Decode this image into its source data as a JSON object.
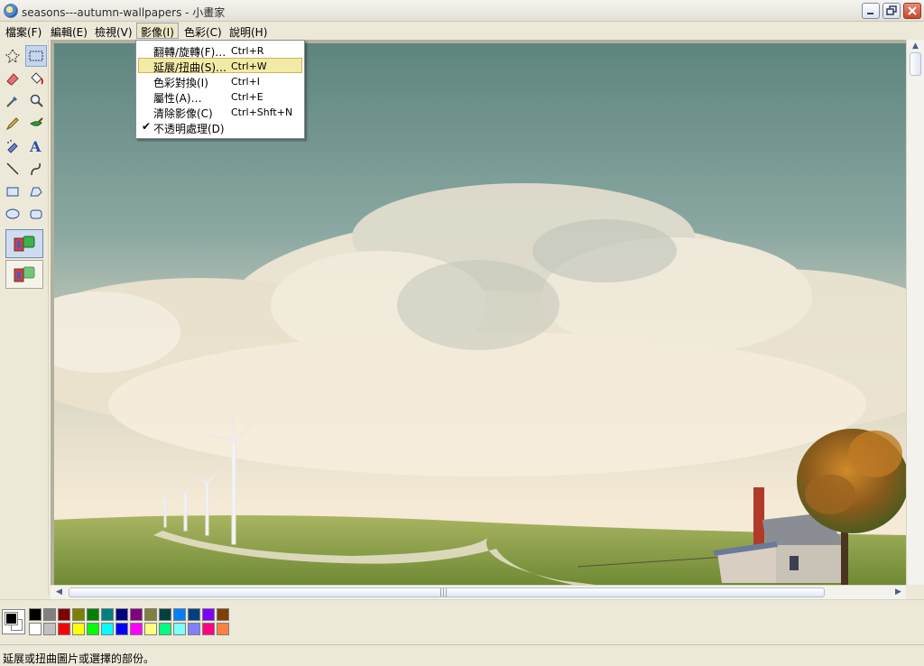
{
  "window": {
    "title": "seasons---autumn-wallpapers - 小畫家"
  },
  "menubar": {
    "file": "檔案(F)",
    "edit": "編輯(E)",
    "view": "檢視(V)",
    "image": "影像(I)",
    "colors": "色彩(C)",
    "help": "說明(H)"
  },
  "image_menu": {
    "items": [
      {
        "label": "翻轉/旋轉(F)…",
        "shortcut": "Ctrl+R"
      },
      {
        "label": "延展/扭曲(S)…",
        "shortcut": "Ctrl+W",
        "highlighted": true
      },
      {
        "label": "色彩對換(I)",
        "shortcut": "Ctrl+I"
      },
      {
        "label": "屬性(A)…",
        "shortcut": "Ctrl+E"
      },
      {
        "label": "清除影像(C)",
        "shortcut": "Ctrl+Shft+N"
      },
      {
        "label": "不透明處理(D)",
        "shortcut": "",
        "checked": true
      }
    ],
    "check_mark": "✔"
  },
  "tools": [
    "free-form-select",
    "select",
    "eraser",
    "fill-with-color",
    "pick-color",
    "magnifier",
    "pencil",
    "brush",
    "airbrush",
    "text",
    "line",
    "curve",
    "rectangle",
    "polygon",
    "ellipse",
    "rounded-rectangle"
  ],
  "palette": {
    "foreground": "#000000",
    "background": "#ffffff",
    "colors_row1": [
      "#000000",
      "#808080",
      "#800000",
      "#808000",
      "#008000",
      "#008080",
      "#000080",
      "#800080",
      "#808040",
      "#004040",
      "#0080ff",
      "#004080",
      "#8000ff",
      "#804000"
    ],
    "colors_row2": [
      "#ffffff",
      "#c0c0c0",
      "#ff0000",
      "#ffff00",
      "#00ff00",
      "#00ffff",
      "#0000ff",
      "#ff00ff",
      "#ffff80",
      "#00ff80",
      "#80ffff",
      "#8080ff",
      "#ff0080",
      "#ff8040"
    ]
  },
  "scrollbar": {
    "grip": "|||"
  },
  "status": {
    "text": "延展或扭曲圖片或選擇的部份。"
  }
}
